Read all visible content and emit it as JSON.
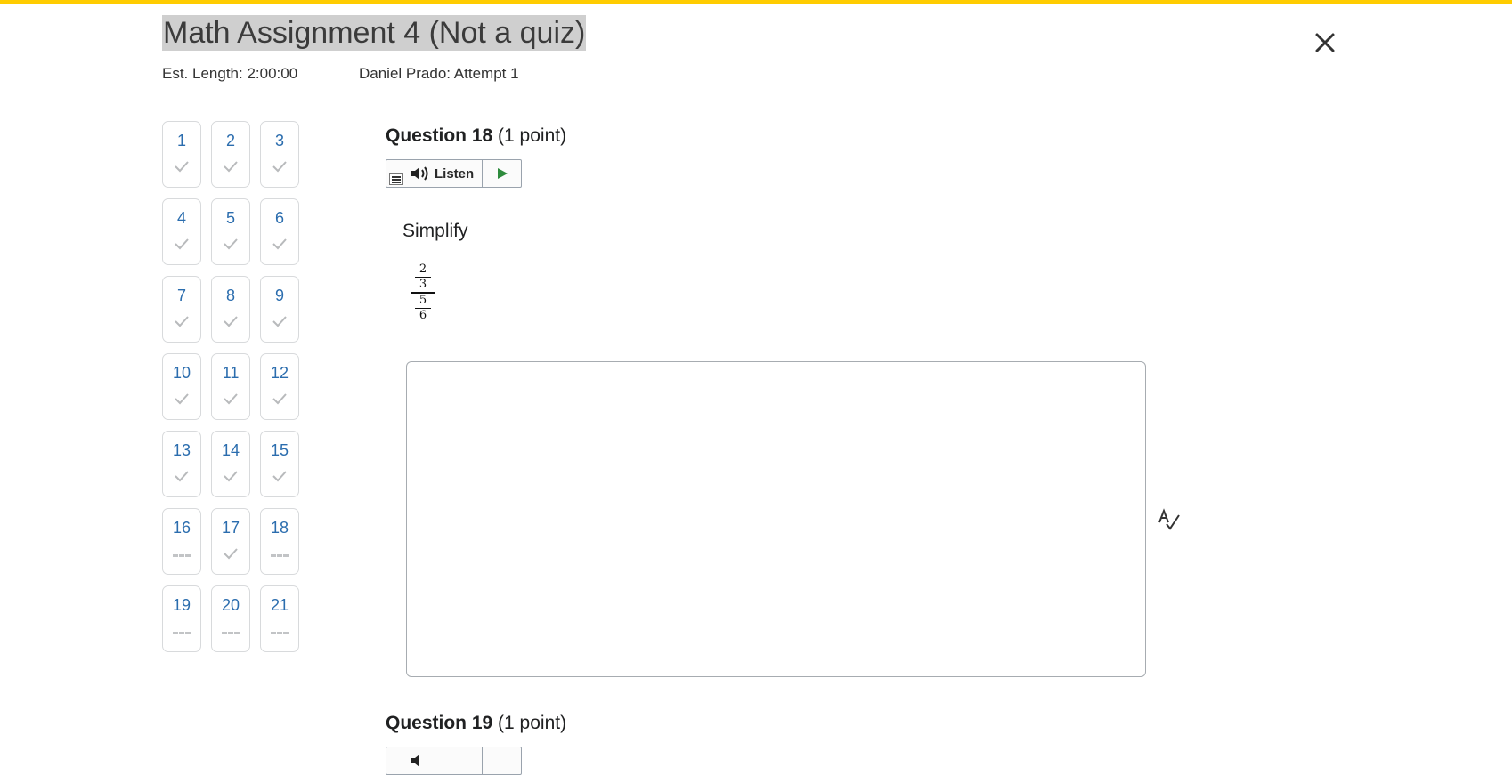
{
  "page": {
    "title": "Math Assignment 4 (Not a quiz)",
    "est_length": "Est. Length: 2:00:00",
    "attempt": "Daniel Prado: Attempt 1",
    "close_icon": "close-icon",
    "accent_color": "#ffcc00"
  },
  "question_nav": [
    {
      "num": "1",
      "status": "answered"
    },
    {
      "num": "2",
      "status": "answered"
    },
    {
      "num": "3",
      "status": "answered"
    },
    {
      "num": "4",
      "status": "answered"
    },
    {
      "num": "5",
      "status": "answered"
    },
    {
      "num": "6",
      "status": "answered"
    },
    {
      "num": "7",
      "status": "answered"
    },
    {
      "num": "8",
      "status": "answered"
    },
    {
      "num": "9",
      "status": "answered"
    },
    {
      "num": "10",
      "status": "answered"
    },
    {
      "num": "11",
      "status": "answered"
    },
    {
      "num": "12",
      "status": "answered"
    },
    {
      "num": "13",
      "status": "answered"
    },
    {
      "num": "14",
      "status": "answered"
    },
    {
      "num": "15",
      "status": "answered"
    },
    {
      "num": "16",
      "status": "unanswered"
    },
    {
      "num": "17",
      "status": "answered"
    },
    {
      "num": "18",
      "status": "unanswered"
    },
    {
      "num": "19",
      "status": "unanswered"
    },
    {
      "num": "20",
      "status": "unanswered"
    },
    {
      "num": "21",
      "status": "unanswered"
    }
  ],
  "listen": {
    "label": "Listen",
    "icons": [
      "menu-icon",
      "speaker-icon",
      "play-icon"
    ]
  },
  "questions": [
    {
      "title": "Question 18",
      "points": "(1 point)",
      "prompt": "Simplify",
      "fraction": {
        "inner_num": "2",
        "inner_den": "3",
        "outer_num": "5",
        "outer_den": "6"
      },
      "answer_value": "",
      "spellcheck_icon": "spellcheck-icon"
    },
    {
      "title": "Question 19",
      "points": "(1 point)"
    }
  ]
}
